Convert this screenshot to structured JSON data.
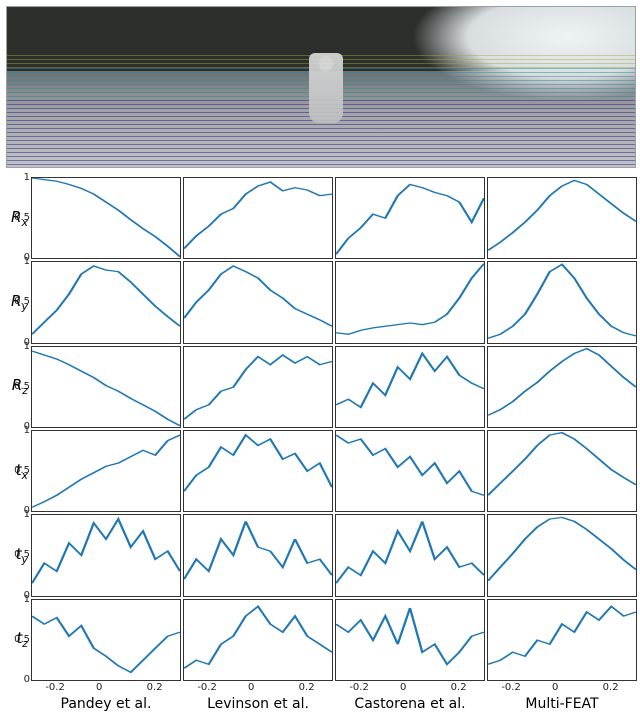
{
  "image": {
    "alt": "Camera image with projected LiDAR scan lines (KITTI-style street scene, motorcyclist in center, trees left, houses right)"
  },
  "axes": {
    "x_ticks": [
      -0.2,
      0,
      0.2
    ],
    "x_range": [
      -0.3,
      0.3
    ],
    "y_ticks": [
      0,
      0.5,
      1
    ],
    "y_range": [
      0,
      1.0
    ]
  },
  "methods": [
    "Pandey et al.",
    "Levinson et al.",
    "Castorena et al.",
    "Multi-FEAT"
  ],
  "params": [
    "R_x",
    "R_y",
    "R_z",
    "t_x",
    "t_y",
    "t_z"
  ],
  "param_labels": [
    {
      "sym": "R",
      "sub": "x"
    },
    {
      "sym": "R",
      "sub": "y"
    },
    {
      "sym": "R",
      "sub": "z"
    },
    {
      "sym": "t",
      "sub": "x"
    },
    {
      "sym": "t",
      "sub": "y"
    },
    {
      "sym": "t",
      "sub": "z"
    }
  ],
  "chart_data": [
    {
      "param": "R_x",
      "type": "line",
      "xlabel": "",
      "ylabel": "R_x",
      "ylim": [
        0,
        1
      ],
      "xlim": [
        -0.3,
        0.3
      ],
      "x": [
        -0.3,
        -0.25,
        -0.2,
        -0.15,
        -0.1,
        -0.05,
        0.0,
        0.05,
        0.1,
        0.15,
        0.2,
        0.25,
        0.3
      ],
      "series": [
        {
          "name": "Pandey et al.",
          "values": [
            1.0,
            0.98,
            0.96,
            0.92,
            0.87,
            0.8,
            0.7,
            0.6,
            0.48,
            0.37,
            0.27,
            0.15,
            0.02
          ]
        },
        {
          "name": "Levinson et al.",
          "values": [
            0.12,
            0.28,
            0.4,
            0.55,
            0.62,
            0.8,
            0.9,
            0.95,
            0.84,
            0.88,
            0.85,
            0.78,
            0.8
          ]
        },
        {
          "name": "Castorena et al.",
          "values": [
            0.05,
            0.25,
            0.38,
            0.55,
            0.5,
            0.78,
            0.92,
            0.88,
            0.82,
            0.78,
            0.7,
            0.45,
            0.75
          ]
        },
        {
          "name": "Multi-FEAT",
          "values": [
            0.1,
            0.2,
            0.32,
            0.45,
            0.6,
            0.78,
            0.9,
            0.97,
            0.92,
            0.8,
            0.68,
            0.56,
            0.46
          ]
        }
      ]
    },
    {
      "param": "R_y",
      "type": "line",
      "xlabel": "",
      "ylabel": "R_y",
      "ylim": [
        0,
        1
      ],
      "xlim": [
        -0.3,
        0.3
      ],
      "x": [
        -0.3,
        -0.25,
        -0.2,
        -0.15,
        -0.1,
        -0.05,
        0.0,
        0.05,
        0.1,
        0.15,
        0.2,
        0.25,
        0.3
      ],
      "series": [
        {
          "name": "Pandey et al.",
          "values": [
            0.1,
            0.25,
            0.4,
            0.6,
            0.85,
            0.95,
            0.9,
            0.88,
            0.75,
            0.6,
            0.45,
            0.32,
            0.2
          ]
        },
        {
          "name": "Levinson et al.",
          "values": [
            0.3,
            0.5,
            0.65,
            0.85,
            0.95,
            0.88,
            0.8,
            0.65,
            0.55,
            0.42,
            0.35,
            0.28,
            0.2
          ]
        },
        {
          "name": "Castorena et al.",
          "values": [
            0.12,
            0.1,
            0.15,
            0.18,
            0.2,
            0.22,
            0.24,
            0.22,
            0.25,
            0.35,
            0.55,
            0.8,
            0.98
          ]
        },
        {
          "name": "Multi-FEAT",
          "values": [
            0.05,
            0.1,
            0.2,
            0.35,
            0.6,
            0.88,
            0.97,
            0.8,
            0.55,
            0.35,
            0.2,
            0.12,
            0.08
          ]
        }
      ]
    },
    {
      "param": "R_z",
      "type": "line",
      "xlabel": "",
      "ylabel": "R_z",
      "ylim": [
        0,
        1
      ],
      "xlim": [
        -0.3,
        0.3
      ],
      "x": [
        -0.3,
        -0.25,
        -0.2,
        -0.15,
        -0.1,
        -0.05,
        0.0,
        0.05,
        0.1,
        0.15,
        0.2,
        0.25,
        0.3
      ],
      "series": [
        {
          "name": "Pandey et al.",
          "values": [
            0.95,
            0.9,
            0.85,
            0.78,
            0.7,
            0.62,
            0.52,
            0.45,
            0.36,
            0.28,
            0.2,
            0.1,
            0.02
          ]
        },
        {
          "name": "Levinson et al.",
          "values": [
            0.1,
            0.22,
            0.28,
            0.45,
            0.5,
            0.72,
            0.88,
            0.78,
            0.9,
            0.8,
            0.88,
            0.78,
            0.82
          ]
        },
        {
          "name": "Castorena et al.",
          "values": [
            0.28,
            0.35,
            0.25,
            0.55,
            0.4,
            0.75,
            0.6,
            0.92,
            0.7,
            0.88,
            0.65,
            0.55,
            0.48
          ]
        },
        {
          "name": "Multi-FEAT",
          "values": [
            0.15,
            0.22,
            0.32,
            0.45,
            0.56,
            0.7,
            0.82,
            0.92,
            0.98,
            0.9,
            0.76,
            0.62,
            0.5
          ]
        }
      ]
    },
    {
      "param": "t_x",
      "type": "line",
      "xlabel": "",
      "ylabel": "t_x",
      "ylim": [
        0,
        1
      ],
      "xlim": [
        -0.3,
        0.3
      ],
      "x": [
        -0.3,
        -0.25,
        -0.2,
        -0.15,
        -0.1,
        -0.05,
        0.0,
        0.05,
        0.1,
        0.15,
        0.2,
        0.25,
        0.3
      ],
      "series": [
        {
          "name": "Pandey et al.",
          "values": [
            0.05,
            0.12,
            0.2,
            0.3,
            0.4,
            0.48,
            0.56,
            0.6,
            0.68,
            0.76,
            0.7,
            0.88,
            0.95
          ]
        },
        {
          "name": "Levinson et al.",
          "values": [
            0.25,
            0.45,
            0.55,
            0.8,
            0.7,
            0.95,
            0.82,
            0.9,
            0.65,
            0.72,
            0.5,
            0.6,
            0.3
          ]
        },
        {
          "name": "Castorena et al.",
          "values": [
            0.95,
            0.85,
            0.9,
            0.7,
            0.78,
            0.55,
            0.68,
            0.45,
            0.6,
            0.35,
            0.5,
            0.25,
            0.2
          ]
        },
        {
          "name": "Multi-FEAT",
          "values": [
            0.2,
            0.35,
            0.5,
            0.65,
            0.82,
            0.95,
            0.98,
            0.9,
            0.78,
            0.65,
            0.52,
            0.42,
            0.33
          ]
        }
      ]
    },
    {
      "param": "t_y",
      "type": "line",
      "xlabel": "",
      "ylabel": "t_y",
      "ylim": [
        0,
        1
      ],
      "xlim": [
        -0.3,
        0.3
      ],
      "x": [
        -0.3,
        -0.25,
        -0.2,
        -0.15,
        -0.1,
        -0.05,
        0.0,
        0.05,
        0.1,
        0.15,
        0.2,
        0.25,
        0.3
      ],
      "series": [
        {
          "name": "Pandey et al.",
          "values": [
            0.15,
            0.4,
            0.3,
            0.65,
            0.5,
            0.9,
            0.7,
            0.95,
            0.6,
            0.8,
            0.45,
            0.55,
            0.3
          ]
        },
        {
          "name": "Levinson et al.",
          "values": [
            0.2,
            0.45,
            0.3,
            0.7,
            0.5,
            0.92,
            0.6,
            0.55,
            0.35,
            0.7,
            0.4,
            0.45,
            0.25
          ]
        },
        {
          "name": "Castorena et al.",
          "values": [
            0.15,
            0.35,
            0.25,
            0.55,
            0.4,
            0.8,
            0.55,
            0.92,
            0.45,
            0.6,
            0.35,
            0.4,
            0.25
          ]
        },
        {
          "name": "Multi-FEAT",
          "values": [
            0.18,
            0.35,
            0.52,
            0.7,
            0.85,
            0.95,
            0.97,
            0.92,
            0.82,
            0.7,
            0.58,
            0.44,
            0.32
          ]
        }
      ]
    },
    {
      "param": "t_z",
      "type": "line",
      "xlabel": "",
      "ylabel": "t_z",
      "ylim": [
        0,
        1
      ],
      "xlim": [
        -0.3,
        0.3
      ],
      "x": [
        -0.3,
        -0.25,
        -0.2,
        -0.15,
        -0.1,
        -0.05,
        0.0,
        0.05,
        0.1,
        0.15,
        0.2,
        0.25,
        0.3
      ],
      "series": [
        {
          "name": "Pandey et al.",
          "values": [
            0.8,
            0.7,
            0.78,
            0.55,
            0.68,
            0.4,
            0.3,
            0.18,
            0.1,
            0.25,
            0.4,
            0.55,
            0.6
          ]
        },
        {
          "name": "Levinson et al.",
          "values": [
            0.15,
            0.25,
            0.2,
            0.45,
            0.55,
            0.8,
            0.92,
            0.7,
            0.6,
            0.8,
            0.55,
            0.45,
            0.35
          ]
        },
        {
          "name": "Castorena et al.",
          "values": [
            0.7,
            0.6,
            0.75,
            0.5,
            0.8,
            0.45,
            0.9,
            0.35,
            0.45,
            0.2,
            0.35,
            0.55,
            0.6
          ]
        },
        {
          "name": "Multi-FEAT",
          "values": [
            0.2,
            0.25,
            0.35,
            0.3,
            0.5,
            0.45,
            0.7,
            0.6,
            0.85,
            0.75,
            0.92,
            0.8,
            0.85
          ]
        }
      ]
    }
  ]
}
